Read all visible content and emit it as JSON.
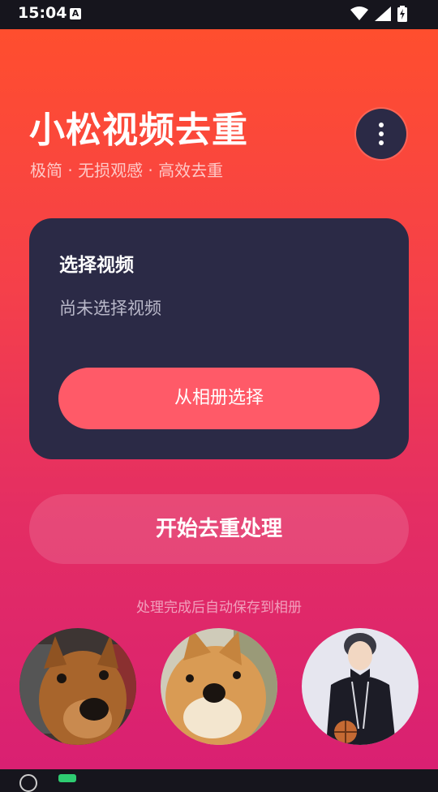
{
  "status_bar": {
    "time": "15:04",
    "notification_icon": "font-a-icon",
    "icons": [
      "wifi-icon",
      "signal-icon",
      "battery-charging-icon"
    ]
  },
  "header": {
    "title": "小松视频去重",
    "subtitle": "极简 · 无损观感 · 高效去重",
    "menu_icon": "more-vertical-icon"
  },
  "card": {
    "title": "选择视频",
    "status": "尚未选择视频",
    "button_label": "从相册选择"
  },
  "actions": {
    "start_label": "开始去重处理",
    "hint": "处理完成后自动保存到相册"
  },
  "avatars": [
    {
      "name": "brown-dog-avatar"
    },
    {
      "name": "shiba-dog-avatar"
    },
    {
      "name": "person-basketball-avatar"
    }
  ],
  "colors": {
    "accent": "#ff5a68",
    "card": "#2b2a46",
    "gradient_top": "#ff4e2e",
    "gradient_bottom": "#d92072"
  }
}
